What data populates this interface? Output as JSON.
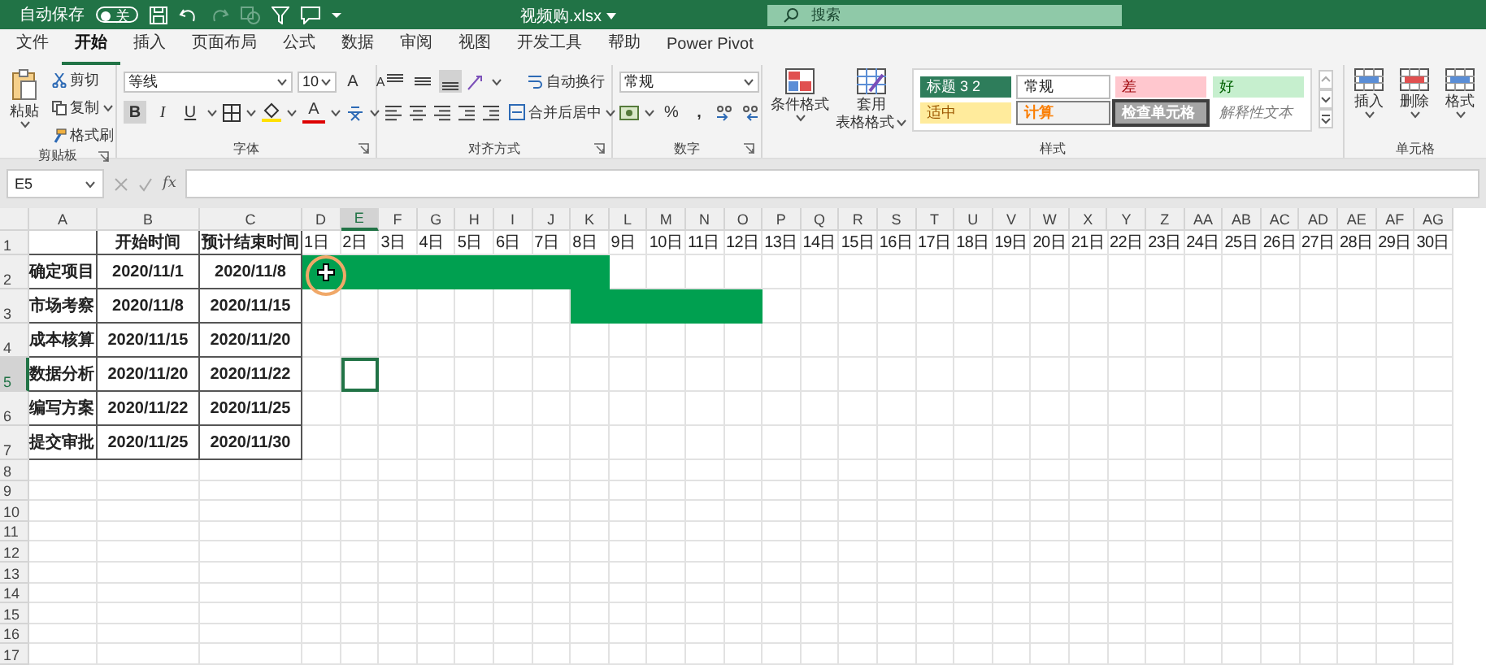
{
  "title_bar": {
    "autosave_label": "自动保存",
    "autosave_state": "关",
    "autosave_on": false,
    "filename": "视频购.xlsx",
    "search_placeholder": "搜索"
  },
  "tabs": [
    {
      "label": "文件",
      "selected": false
    },
    {
      "label": "开始",
      "selected": true
    },
    {
      "label": "插入",
      "selected": false
    },
    {
      "label": "页面布局",
      "selected": false
    },
    {
      "label": "公式",
      "selected": false
    },
    {
      "label": "数据",
      "selected": false
    },
    {
      "label": "审阅",
      "selected": false
    },
    {
      "label": "视图",
      "selected": false
    },
    {
      "label": "开发工具",
      "selected": false
    },
    {
      "label": "帮助",
      "selected": false
    },
    {
      "label": "Power Pivot",
      "selected": false
    }
  ],
  "clipboard": {
    "label": "剪贴板",
    "paste": "粘贴",
    "cut": "剪切",
    "copy": "复制",
    "format_painter": "格式刷"
  },
  "font": {
    "label": "字体",
    "name": "等线",
    "size": "10",
    "grow": "A",
    "shrink": "A",
    "bold": {
      "text": "B",
      "selected": true
    },
    "italic": "I",
    "underline": "U",
    "font_color": "A"
  },
  "alignment": {
    "label": "对齐方式",
    "wrap": "自动换行",
    "merge": "合并后居中",
    "vertical": [
      {
        "selected": false
      },
      {
        "selected": false
      },
      {
        "selected": true
      }
    ]
  },
  "number": {
    "label": "数字",
    "format": "常规",
    "percent": "%",
    "comma": ","
  },
  "styles": {
    "label": "样式",
    "conditional": "条件格式",
    "table_format": [
      "套用",
      "表格格式"
    ],
    "gallery": [
      {
        "text": "标题 3 2",
        "kind": "title",
        "color": "#2e7d5b"
      },
      {
        "text": "常规",
        "kind": "normal",
        "color": "#ffffff"
      },
      {
        "text": "差",
        "kind": "bad",
        "color": "#ffc7ce"
      },
      {
        "text": "好",
        "kind": "good",
        "color": "#c6efce"
      },
      {
        "text": "适中",
        "kind": "neutral",
        "color": "#ffeb9c"
      },
      {
        "text": "计算",
        "kind": "calc",
        "color": "#f2f2f2"
      },
      {
        "text": "检查单元格",
        "kind": "check",
        "color": "#a5a5a5"
      },
      {
        "text": "解释性文本",
        "kind": "explanatory",
        "color": "#ffffff"
      }
    ]
  },
  "cells_group": {
    "label": "单元格",
    "insert": "插入",
    "delete": "删除",
    "format": "格式"
  },
  "formula_bar": {
    "name_box": "E5",
    "fx": "fx"
  },
  "columns": [
    {
      "label": "A",
      "selected": false
    },
    {
      "label": "B",
      "selected": false
    },
    {
      "label": "C",
      "selected": false
    },
    {
      "label": "D",
      "selected": false
    },
    {
      "label": "E",
      "selected": true
    },
    {
      "label": "F",
      "selected": false
    },
    {
      "label": "G",
      "selected": false
    },
    {
      "label": "H",
      "selected": false
    },
    {
      "label": "I",
      "selected": false
    },
    {
      "label": "J",
      "selected": false
    },
    {
      "label": "K",
      "selected": false
    },
    {
      "label": "L",
      "selected": false
    },
    {
      "label": "M",
      "selected": false
    },
    {
      "label": "N",
      "selected": false
    },
    {
      "label": "O",
      "selected": false
    },
    {
      "label": "P",
      "selected": false
    },
    {
      "label": "Q",
      "selected": false
    },
    {
      "label": "R",
      "selected": false
    },
    {
      "label": "S",
      "selected": false
    },
    {
      "label": "T",
      "selected": false
    },
    {
      "label": "U",
      "selected": false
    },
    {
      "label": "V",
      "selected": false
    },
    {
      "label": "W",
      "selected": false
    },
    {
      "label": "X",
      "selected": false
    },
    {
      "label": "Y",
      "selected": false
    },
    {
      "label": "Z",
      "selected": false
    },
    {
      "label": "AA",
      "selected": false
    },
    {
      "label": "AB",
      "selected": false
    },
    {
      "label": "AC",
      "selected": false
    },
    {
      "label": "AD",
      "selected": false
    },
    {
      "label": "AE",
      "selected": false
    },
    {
      "label": "AF",
      "selected": false
    },
    {
      "label": "AG",
      "selected": false
    }
  ],
  "header_row": {
    "number": "1",
    "start_heading": "开始时间",
    "end_heading": "预计结束时间",
    "days": [
      "1日",
      "2日",
      "3日",
      "4日",
      "5日",
      "6日",
      "7日",
      "8日",
      "9日",
      "10日",
      "11日",
      "12日",
      "13日",
      "14日",
      "15日",
      "16日",
      "17日",
      "18日",
      "19日",
      "20日",
      "21日",
      "22日",
      "23日",
      "24日",
      "25日",
      "26日",
      "27日",
      "28日",
      "29日",
      "30日"
    ]
  },
  "tasks": [
    {
      "number": "2",
      "name": "确定项目",
      "start": "2020/11/1",
      "end": "2020/11/8",
      "selected": false,
      "pointer": true,
      "bar": [
        true,
        true,
        true,
        true,
        true,
        true,
        true,
        true,
        false,
        false,
        false,
        false,
        false,
        false,
        false,
        false,
        false,
        false,
        false,
        false,
        false,
        false,
        false,
        false,
        false,
        false,
        false,
        false,
        false,
        false
      ]
    },
    {
      "number": "3",
      "name": "市场考察",
      "start": "2020/11/8",
      "end": "2020/11/15",
      "selected": false,
      "pointer": false,
      "bar": [
        false,
        false,
        false,
        false,
        false,
        false,
        false,
        true,
        true,
        true,
        true,
        true,
        false,
        false,
        false,
        false,
        false,
        false,
        false,
        false,
        false,
        false,
        false,
        false,
        false,
        false,
        false,
        false,
        false,
        false
      ]
    },
    {
      "number": "4",
      "name": "成本核算",
      "start": "2020/11/15",
      "end": "2020/11/20",
      "selected": false,
      "pointer": false,
      "bar": [
        false,
        false,
        false,
        false,
        false,
        false,
        false,
        false,
        false,
        false,
        false,
        false,
        false,
        false,
        false,
        false,
        false,
        false,
        false,
        false,
        false,
        false,
        false,
        false,
        false,
        false,
        false,
        false,
        false,
        false
      ]
    },
    {
      "number": "5",
      "name": "数据分析",
      "start": "2020/11/20",
      "end": "2020/11/22",
      "selected": true,
      "pointer": false,
      "bar": [
        false,
        false,
        false,
        false,
        false,
        false,
        false,
        false,
        false,
        false,
        false,
        false,
        false,
        false,
        false,
        false,
        false,
        false,
        false,
        false,
        false,
        false,
        false,
        false,
        false,
        false,
        false,
        false,
        false,
        false
      ]
    },
    {
      "number": "6",
      "name": "编写方案",
      "start": "2020/11/22",
      "end": "2020/11/25",
      "selected": false,
      "pointer": false,
      "bar": [
        false,
        false,
        false,
        false,
        false,
        false,
        false,
        false,
        false,
        false,
        false,
        false,
        false,
        false,
        false,
        false,
        false,
        false,
        false,
        false,
        false,
        false,
        false,
        false,
        false,
        false,
        false,
        false,
        false,
        false
      ]
    },
    {
      "number": "7",
      "name": "提交审批",
      "start": "2020/11/25",
      "end": "2020/11/30",
      "selected": false,
      "pointer": false,
      "bar": [
        false,
        false,
        false,
        false,
        false,
        false,
        false,
        false,
        false,
        false,
        false,
        false,
        false,
        false,
        false,
        false,
        false,
        false,
        false,
        false,
        false,
        false,
        false,
        false,
        false,
        false,
        false,
        false,
        false,
        false
      ]
    }
  ],
  "empty_rows": [
    "8",
    "9",
    "10",
    "11",
    "12",
    "13",
    "14",
    "15",
    "16",
    "17"
  ]
}
